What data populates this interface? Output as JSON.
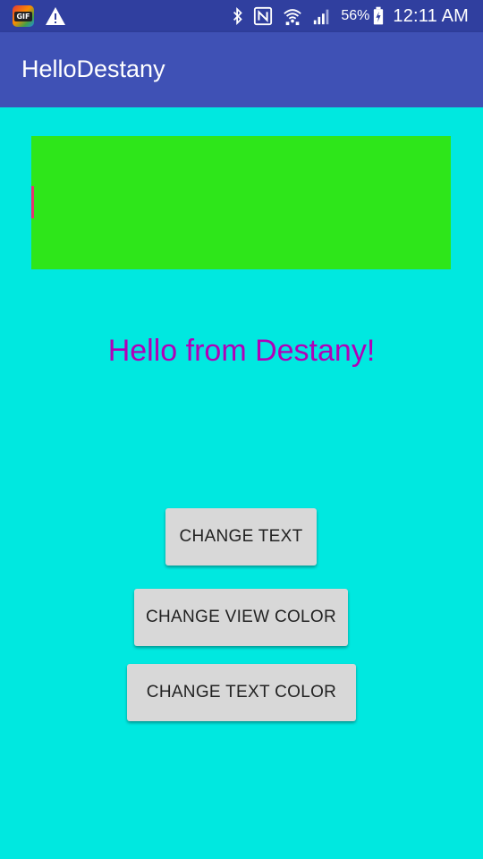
{
  "status_bar": {
    "battery_percent": "56%",
    "time": "12:11 AM",
    "icons": [
      "gif-icon",
      "warning-icon",
      "bluetooth-icon",
      "nfc-icon",
      "wifi-icon",
      "signal-icon",
      "battery-charging-icon"
    ]
  },
  "app_bar": {
    "title": "HelloDestany"
  },
  "main": {
    "hello_text": "Hello from Destany!",
    "buttons": {
      "change_text": "CHANGE TEXT",
      "change_view_color": "CHANGE VIEW COLOR",
      "change_text_color": "CHANGE TEXT COLOR"
    }
  },
  "colors": {
    "background": "#00e8e0",
    "color_view": "#2ee61a",
    "hello_text": "#b100b8",
    "app_bar": "#3f51b5",
    "status_bar": "#303f9f"
  }
}
